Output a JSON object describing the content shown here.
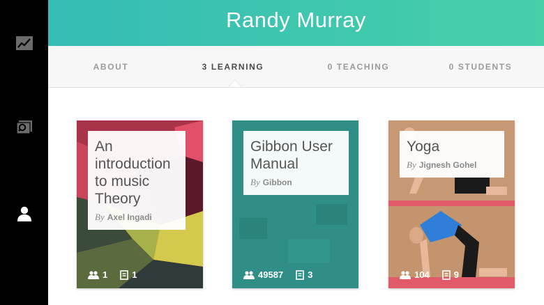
{
  "sidebar": {
    "items": [
      {
        "icon": "chart-icon"
      },
      {
        "icon": "browse-courses-icon"
      },
      {
        "icon": "user-icon"
      }
    ]
  },
  "profile": {
    "name": "Randy Murray"
  },
  "tabs": [
    {
      "label": "ABOUT",
      "active": false
    },
    {
      "label": "3 LEARNING",
      "active": true
    },
    {
      "label": "0 TEACHING",
      "active": false
    },
    {
      "label": "0 STUDENTS",
      "active": false
    }
  ],
  "cards": [
    {
      "title": "An introduction to music Theory",
      "by": "By",
      "author": "Axel Ingadi",
      "learners": "1",
      "lessons": "1",
      "color": "#8a2b3a"
    },
    {
      "title": "Gibbon User Manual",
      "by": "By",
      "author": "Gibbon",
      "learners": "49587",
      "lessons": "3",
      "color": "#2f8f86"
    },
    {
      "title": "Yoga",
      "by": "By",
      "author": "Jignesh Gohel",
      "learners": "104",
      "lessons": "9",
      "color": "#c99b78"
    }
  ]
}
